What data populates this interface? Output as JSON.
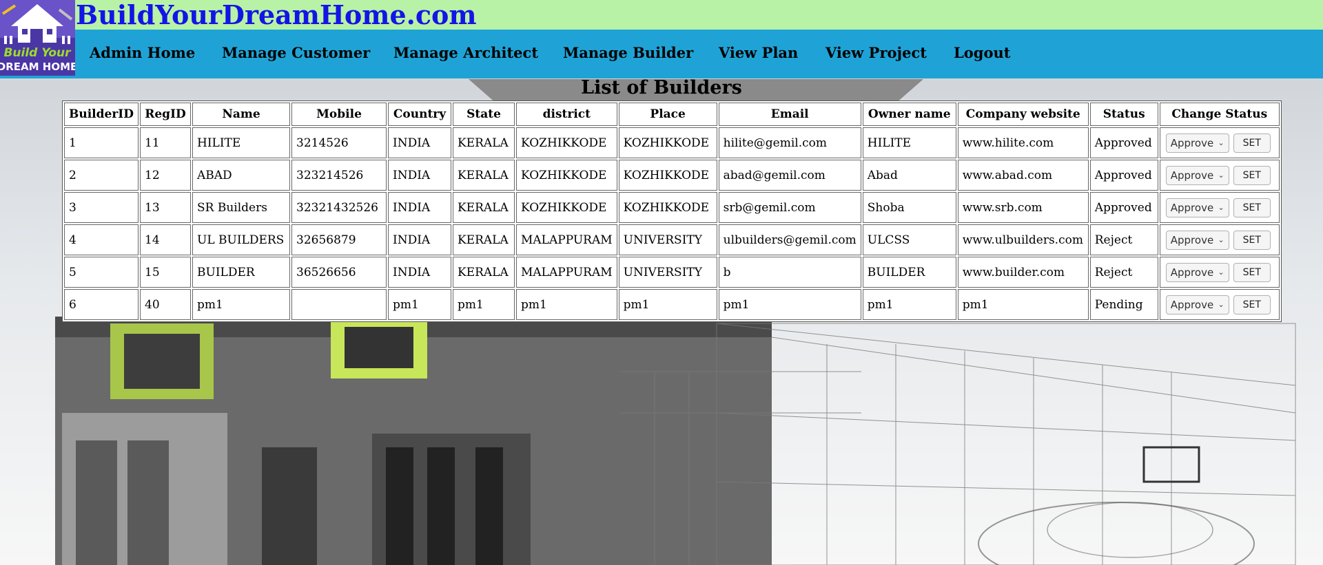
{
  "site": {
    "title": "BuildYourDreamHome.com",
    "logo_text_top": "Build Your",
    "logo_text_bottom": "DREAM HOME",
    "header_bg": "#b8f2a7",
    "nav_bg": "#1fa3d6",
    "title_color": "#1414e6"
  },
  "nav": {
    "admin_home": "Admin Home",
    "manage_customer": "Manage Customer",
    "manage_architect": "Manage Architect",
    "manage_builder": "Manage Builder",
    "view_plan": "View Plan",
    "view_project": "View Project",
    "logout": "Logout"
  },
  "page": {
    "title": "List of Builders"
  },
  "table": {
    "headers": [
      "BuilderID",
      "RegID",
      "Name",
      "Mobile",
      "Country",
      "State",
      "district",
      "Place",
      "Email",
      "Owner name",
      "Company website",
      "Status",
      "Change Status"
    ],
    "rows": [
      {
        "builder_id": "1",
        "reg_id": "11",
        "name": "HILITE",
        "mobile": "3214526",
        "country": "INDIA",
        "state": "KERALA",
        "district": "KOZHIKKODE",
        "place": "KOZHIKKODE",
        "email": "hilite@gemil.com",
        "owner": "HILITE",
        "website": "www.hilite.com",
        "status": "Approved",
        "select": "Approve",
        "button": "SET"
      },
      {
        "builder_id": "2",
        "reg_id": "12",
        "name": "ABAD",
        "mobile": "323214526",
        "country": "INDIA",
        "state": "KERALA",
        "district": "KOZHIKKODE",
        "place": "KOZHIKKODE",
        "email": "abad@gemil.com",
        "owner": "Abad",
        "website": "www.abad.com",
        "status": "Approved",
        "select": "Approve",
        "button": "SET"
      },
      {
        "builder_id": "3",
        "reg_id": "13",
        "name": "SR Builders",
        "mobile": "32321432526",
        "country": "INDIA",
        "state": "KERALA",
        "district": "KOZHIKKODE",
        "place": "KOZHIKKODE",
        "email": "srb@gemil.com",
        "owner": "Shoba",
        "website": "www.srb.com",
        "status": "Approved",
        "select": "Approve",
        "button": "SET"
      },
      {
        "builder_id": "4",
        "reg_id": "14",
        "name": "UL BUILDERS",
        "mobile": "32656879",
        "country": "INDIA",
        "state": "KERALA",
        "district": "MALAPPURAM",
        "place": "UNIVERSITY",
        "email": "ulbuilders@gemil.com",
        "owner": "ULCSS",
        "website": "www.ulbuilders.com",
        "status": "Reject",
        "select": "Approve",
        "button": "SET"
      },
      {
        "builder_id": "5",
        "reg_id": "15",
        "name": "BUILDER",
        "mobile": "36526656",
        "country": "INDIA",
        "state": "KERALA",
        "district": "MALAPPURAM",
        "place": "UNIVERSITY",
        "email": "b",
        "owner": "BUILDER",
        "website": "www.builder.com",
        "status": "Reject",
        "select": "Approve",
        "button": "SET"
      },
      {
        "builder_id": "6",
        "reg_id": "40",
        "name": "pm1",
        "mobile": "",
        "country": "pm1",
        "state": "pm1",
        "district": "pm1",
        "place": "pm1",
        "email": "pm1",
        "owner": "pm1",
        "website": "pm1",
        "status": "Pending",
        "select": "Approve",
        "button": "SET"
      }
    ]
  },
  "icons": {
    "logo": "house-logo-icon",
    "dropdown": "chevron-down-icon"
  }
}
